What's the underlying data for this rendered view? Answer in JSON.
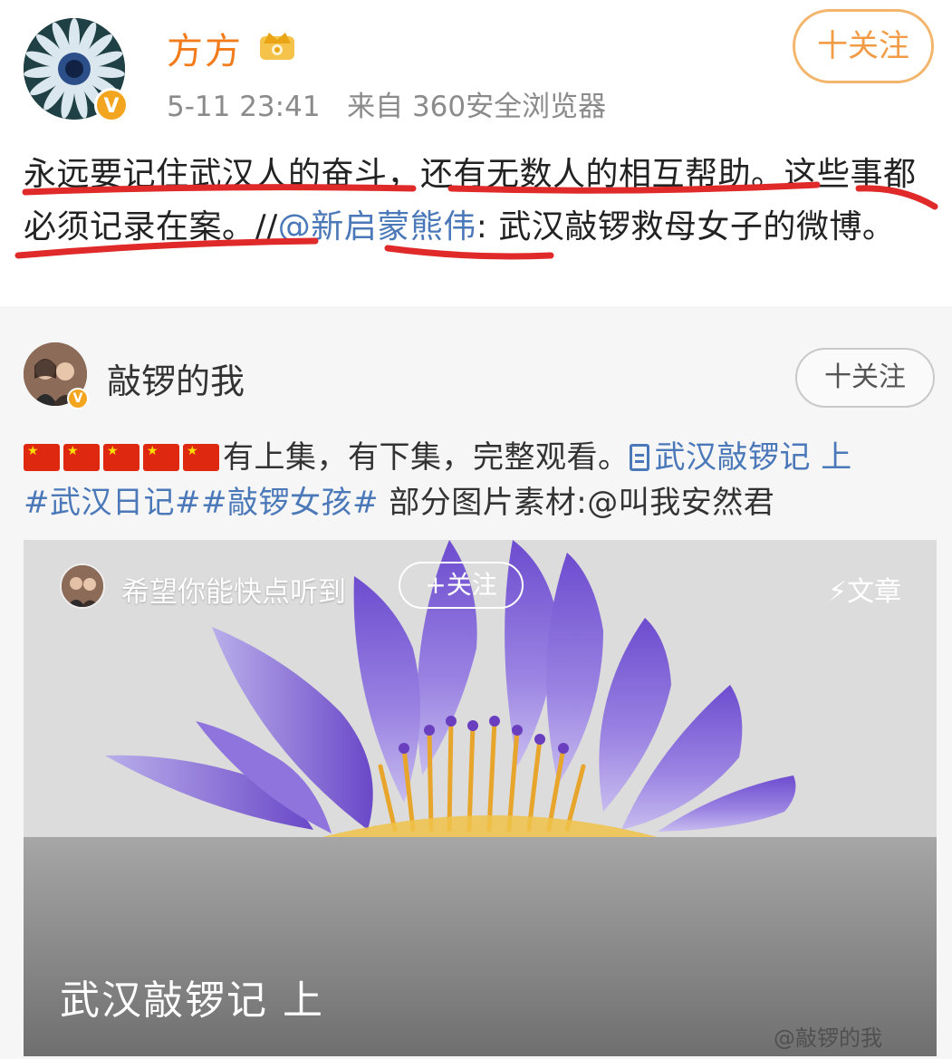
{
  "post": {
    "author": "方方",
    "time": "5-11 23:41",
    "source": "来自 360安全浏览器",
    "follow_label": "十关注",
    "verified_badge": "V",
    "text_main": "永远要记住武汉人的奋斗，还有无数人的相互帮助。这些事都必须记录在案。//",
    "mention": "@新启蒙熊伟",
    "text_tail": ": 武汉敲锣救母女子的微博。",
    "underline_color": "#e02a2a"
  },
  "quoted": {
    "author": "敲锣的我",
    "follow_label": "十关注",
    "text_prefix": "有上集，有下集，完整观看。",
    "article_link": "武汉敲锣记 上",
    "hashtags": "#武汉日记##敲锣女孩#",
    "text_suffix": " 部分图片素材:@叫我安然君",
    "flag_count": 5
  },
  "card": {
    "author": "希望你能快点听到",
    "follow_label": "+关注",
    "article_tag": "⚡文章",
    "title": "武汉敲锣记 上",
    "watermark": "@敲锣的我"
  },
  "colors": {
    "accent_orange": "#f27c1c",
    "link_blue": "#4a78b8",
    "lotus_purple": "#7a5bd0"
  }
}
